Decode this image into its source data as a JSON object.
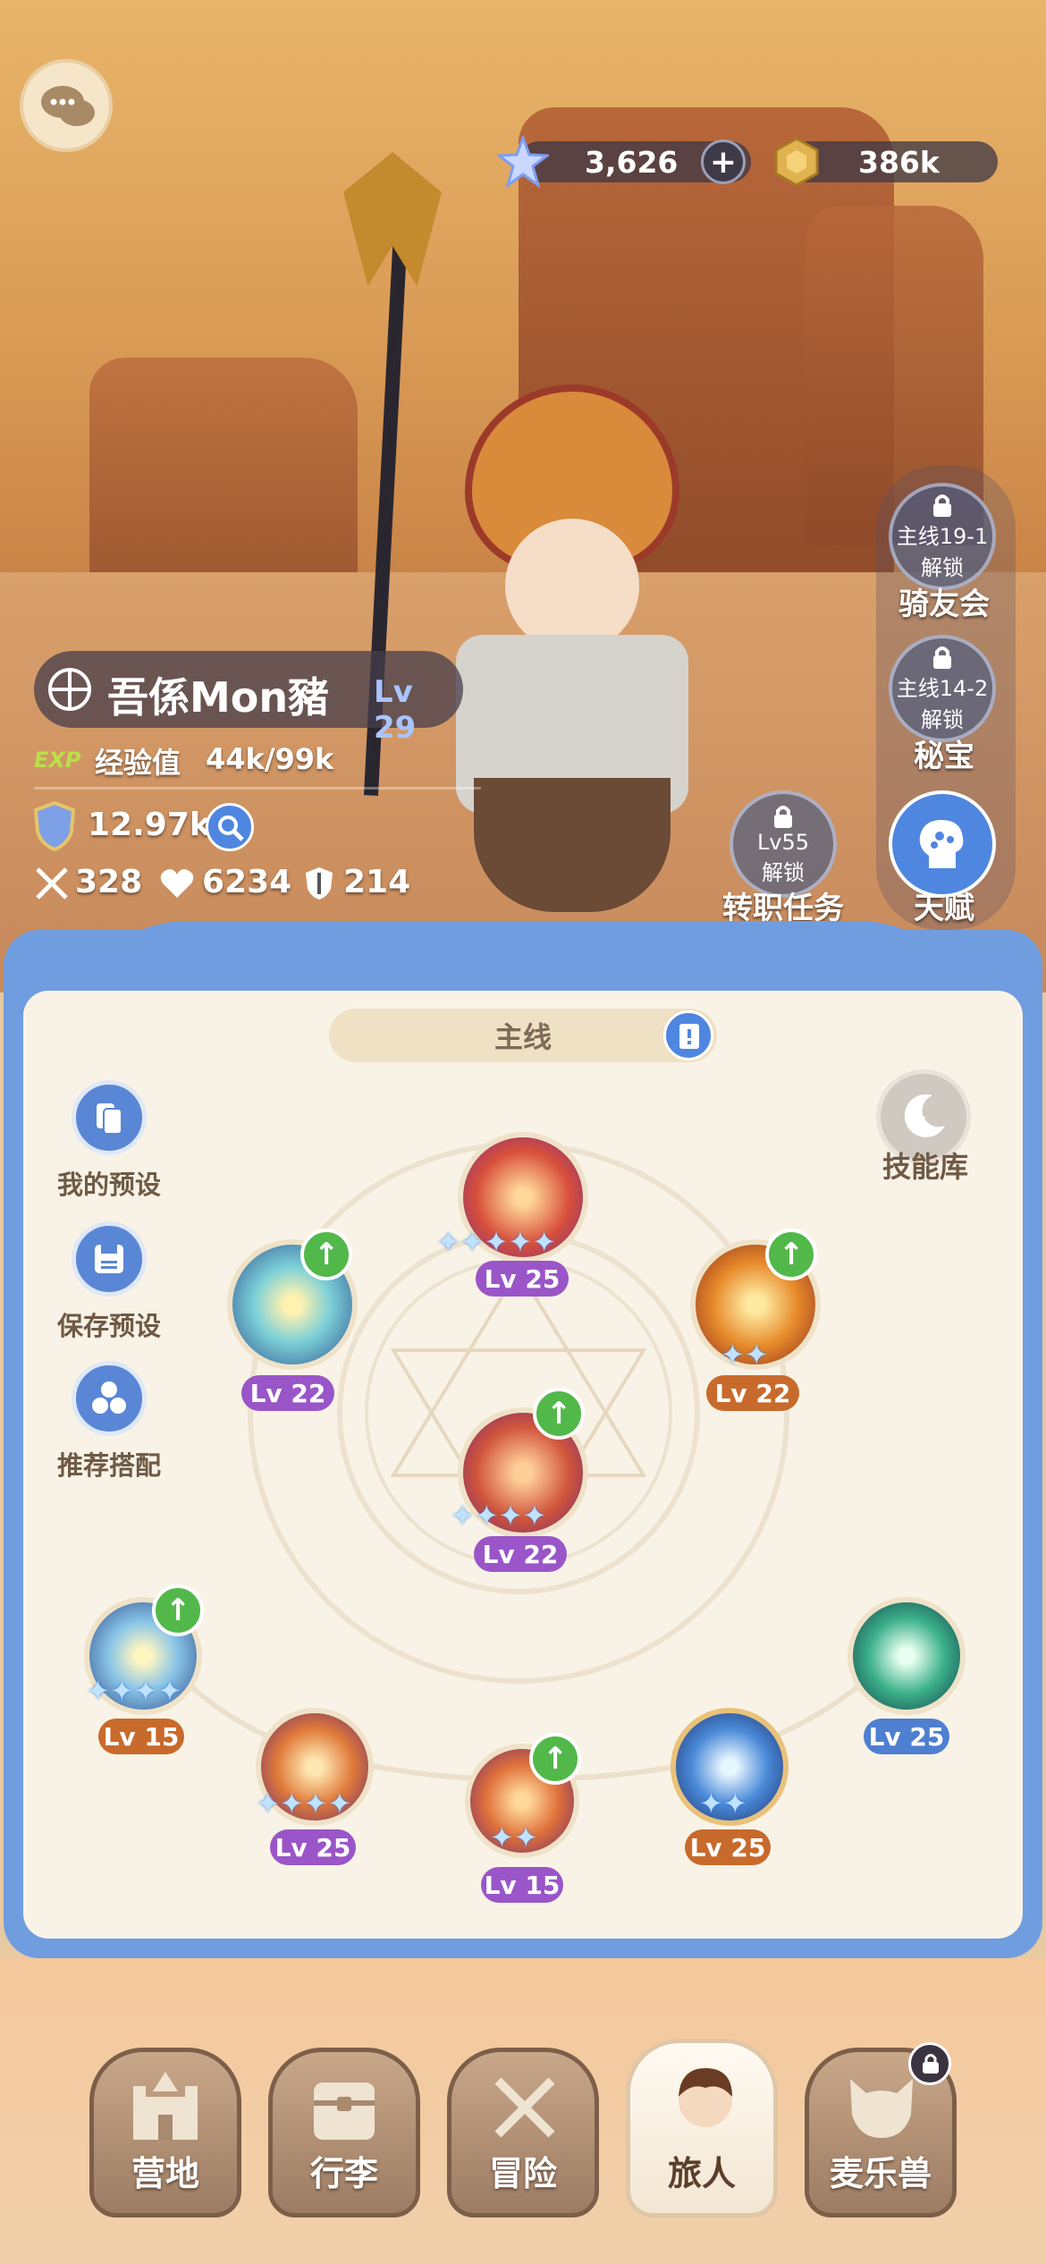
{
  "currency": {
    "gems": "3,626",
    "coins": "386k"
  },
  "player": {
    "name": "吾係Mon豬",
    "level": "Lv 29",
    "exp_tag": "EXP",
    "exp_label": "经验值",
    "exp_value": "44k/99k",
    "power": "12.97k",
    "attack": "328",
    "hp": "6234",
    "defense": "214"
  },
  "side_buttons": [
    {
      "lock_text": "主线19-1",
      "lock_sub": "解锁",
      "label": "骑友会"
    },
    {
      "lock_text": "主线14-2",
      "lock_sub": "解锁",
      "label": "秘宝"
    },
    {
      "lock_text": "Lv55",
      "lock_sub": "解锁",
      "label": "转职任务"
    },
    {
      "label": "天赋"
    }
  ],
  "panel": {
    "tab_label": "主线",
    "skill_library": "技能库",
    "left_actions": [
      "我的预设",
      "保存预设",
      "推荐搭配"
    ]
  },
  "skills": [
    {
      "level": "Lv 25",
      "color": "#9a55c8"
    },
    {
      "level": "Lv 22",
      "color": "#9a55c8"
    },
    {
      "level": "Lv 22",
      "color": "#c86a2b"
    },
    {
      "level": "Lv 22",
      "color": "#9a55c8"
    },
    {
      "level": "Lv 15",
      "color": "#c86a2b"
    },
    {
      "level": "Lv 25",
      "color": "#4f7fd0"
    },
    {
      "level": "Lv 25",
      "color": "#9a55c8"
    },
    {
      "level": "Lv 15",
      "color": "#9a55c8"
    },
    {
      "level": "Lv 25",
      "color": "#c86a2b"
    }
  ],
  "nav": [
    "营地",
    "行李",
    "冒险",
    "旅人",
    "麦乐兽"
  ],
  "icons": [
    "chat-icon",
    "gem-icon",
    "plus-icon",
    "coin-icon",
    "crosshair-icon",
    "shield-icon",
    "search-icon",
    "sword-icon",
    "heart-icon",
    "armor-icon",
    "lock-icon",
    "brain-icon",
    "book-icon",
    "upgrade-arrow-icon"
  ]
}
